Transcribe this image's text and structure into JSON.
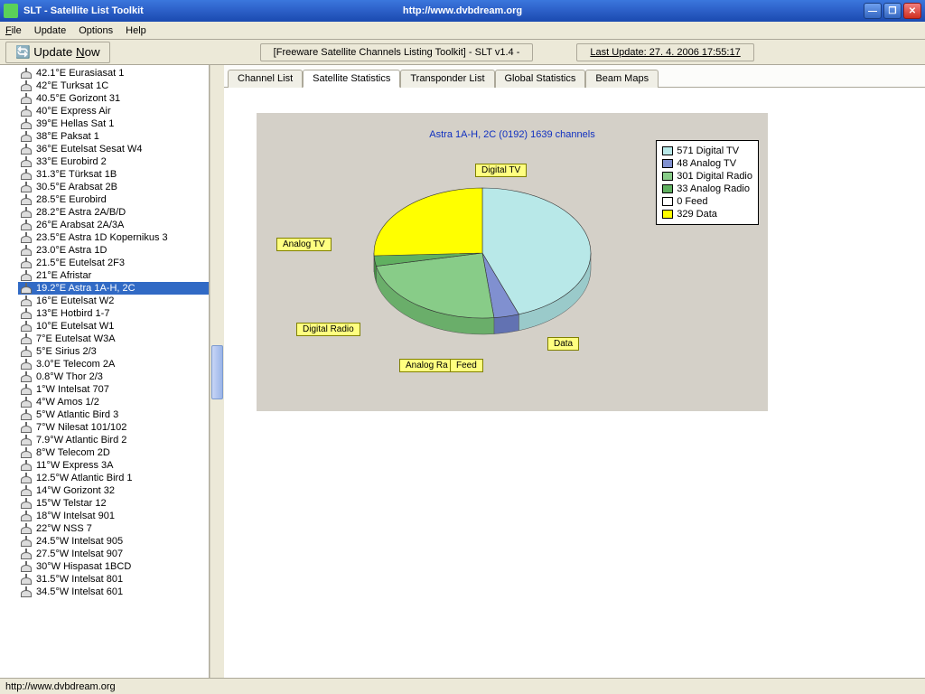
{
  "window": {
    "title": "SLT  -  Satellite List Toolkit",
    "url": "http://www.dvbdream.org"
  },
  "menu": {
    "file": "File",
    "update": "Update",
    "options": "Options",
    "help": "Help"
  },
  "toolbar": {
    "update_now": "Update Now",
    "app_desc": "[Freeware Satellite Channels Listing Toolkit]          - SLT v1.4 -",
    "last_update": "Last Update: 27. 4. 2006 17:55:17"
  },
  "tabs": {
    "channel_list": "Channel List",
    "sat_stats": "Satellite Statistics",
    "transponder": "Transponder List",
    "global_stats": "Global Statistics",
    "beam_maps": "Beam Maps"
  },
  "selected_sat_index": 19,
  "satellites": [
    "42.1°E  Eurasiasat 1",
    "42°E  Turksat 1C",
    "40.5°E  Gorizont 31",
    "40°E  Express Air",
    "39°E  Hellas Sat 1",
    "38°E  Paksat 1",
    "36°E  Eutelsat Sesat W4",
    "33°E  Eurobird 2",
    "31.3°E  Türksat 1B",
    "30.5°E  Arabsat 2B",
    "28.5°E  Eurobird",
    "28.2°E  Astra 2A/B/D",
    "26°E  Arabsat 2A/3A",
    "23.5°E  Astra 1D Kopernikus 3",
    "23.0°E  Astra 1D",
    "21.5°E  Eutelsat 2F3",
    "21°E  Afristar",
    "19.2°E  Astra 1A-H, 2C",
    "16°E  Eutelsat W2",
    "13°E  Hotbird 1-7",
    "10°E  Eutelsat W1",
    "7°E  Eutelsat W3A",
    "5°E  Sirius 2/3",
    "3.0°E  Telecom 2A",
    "0.8°W  Thor 2/3",
    "1°W  Intelsat 707",
    "4°W  Amos 1/2",
    "5°W  Atlantic Bird 3",
    "7°W  Nilesat 101/102",
    "7.9°W  Atlantic Bird 2",
    "8°W  Telecom 2D",
    "11°W  Express 3A",
    "12.5°W  Atlantic Bird 1",
    "14°W  Gorizont 32",
    "15°W  Telstar 12",
    "18°W  Intelsat 901",
    "22°W  NSS 7",
    "24.5°W  Intelsat 905",
    "27.5°W  Intelsat 907",
    "30°W  Hispasat 1BCD",
    "31.5°W  Intelsat 801",
    "34.5°W  Intelsat 601"
  ],
  "chart_title": "Astra 1A-H, 2C  (0192)      1639 channels",
  "chart_data": {
    "type": "pie",
    "title": "Astra 1A-H, 2C (0192) — 1639 channels",
    "series": [
      {
        "name": "Digital TV",
        "value": 571,
        "color": "#b8e8e8"
      },
      {
        "name": "Analog TV",
        "value": 48,
        "color": "#8090d0"
      },
      {
        "name": "Digital Radio",
        "value": 301,
        "color": "#88cc88"
      },
      {
        "name": "Analog Radio",
        "value": 33,
        "color": "#60b060"
      },
      {
        "name": "Feed",
        "value": 0,
        "color": "#ffffff"
      },
      {
        "name": "Data",
        "value": 329,
        "color": "#ffff00"
      }
    ]
  },
  "slice_labels": {
    "digital_tv": "Digital TV",
    "analog_tv": "Analog TV",
    "digital_radio": "Digital Radio",
    "analog_radio": "Analog Ra",
    "feed": "Feed",
    "data": "Data"
  },
  "status": "http://www.dvbdream.org"
}
